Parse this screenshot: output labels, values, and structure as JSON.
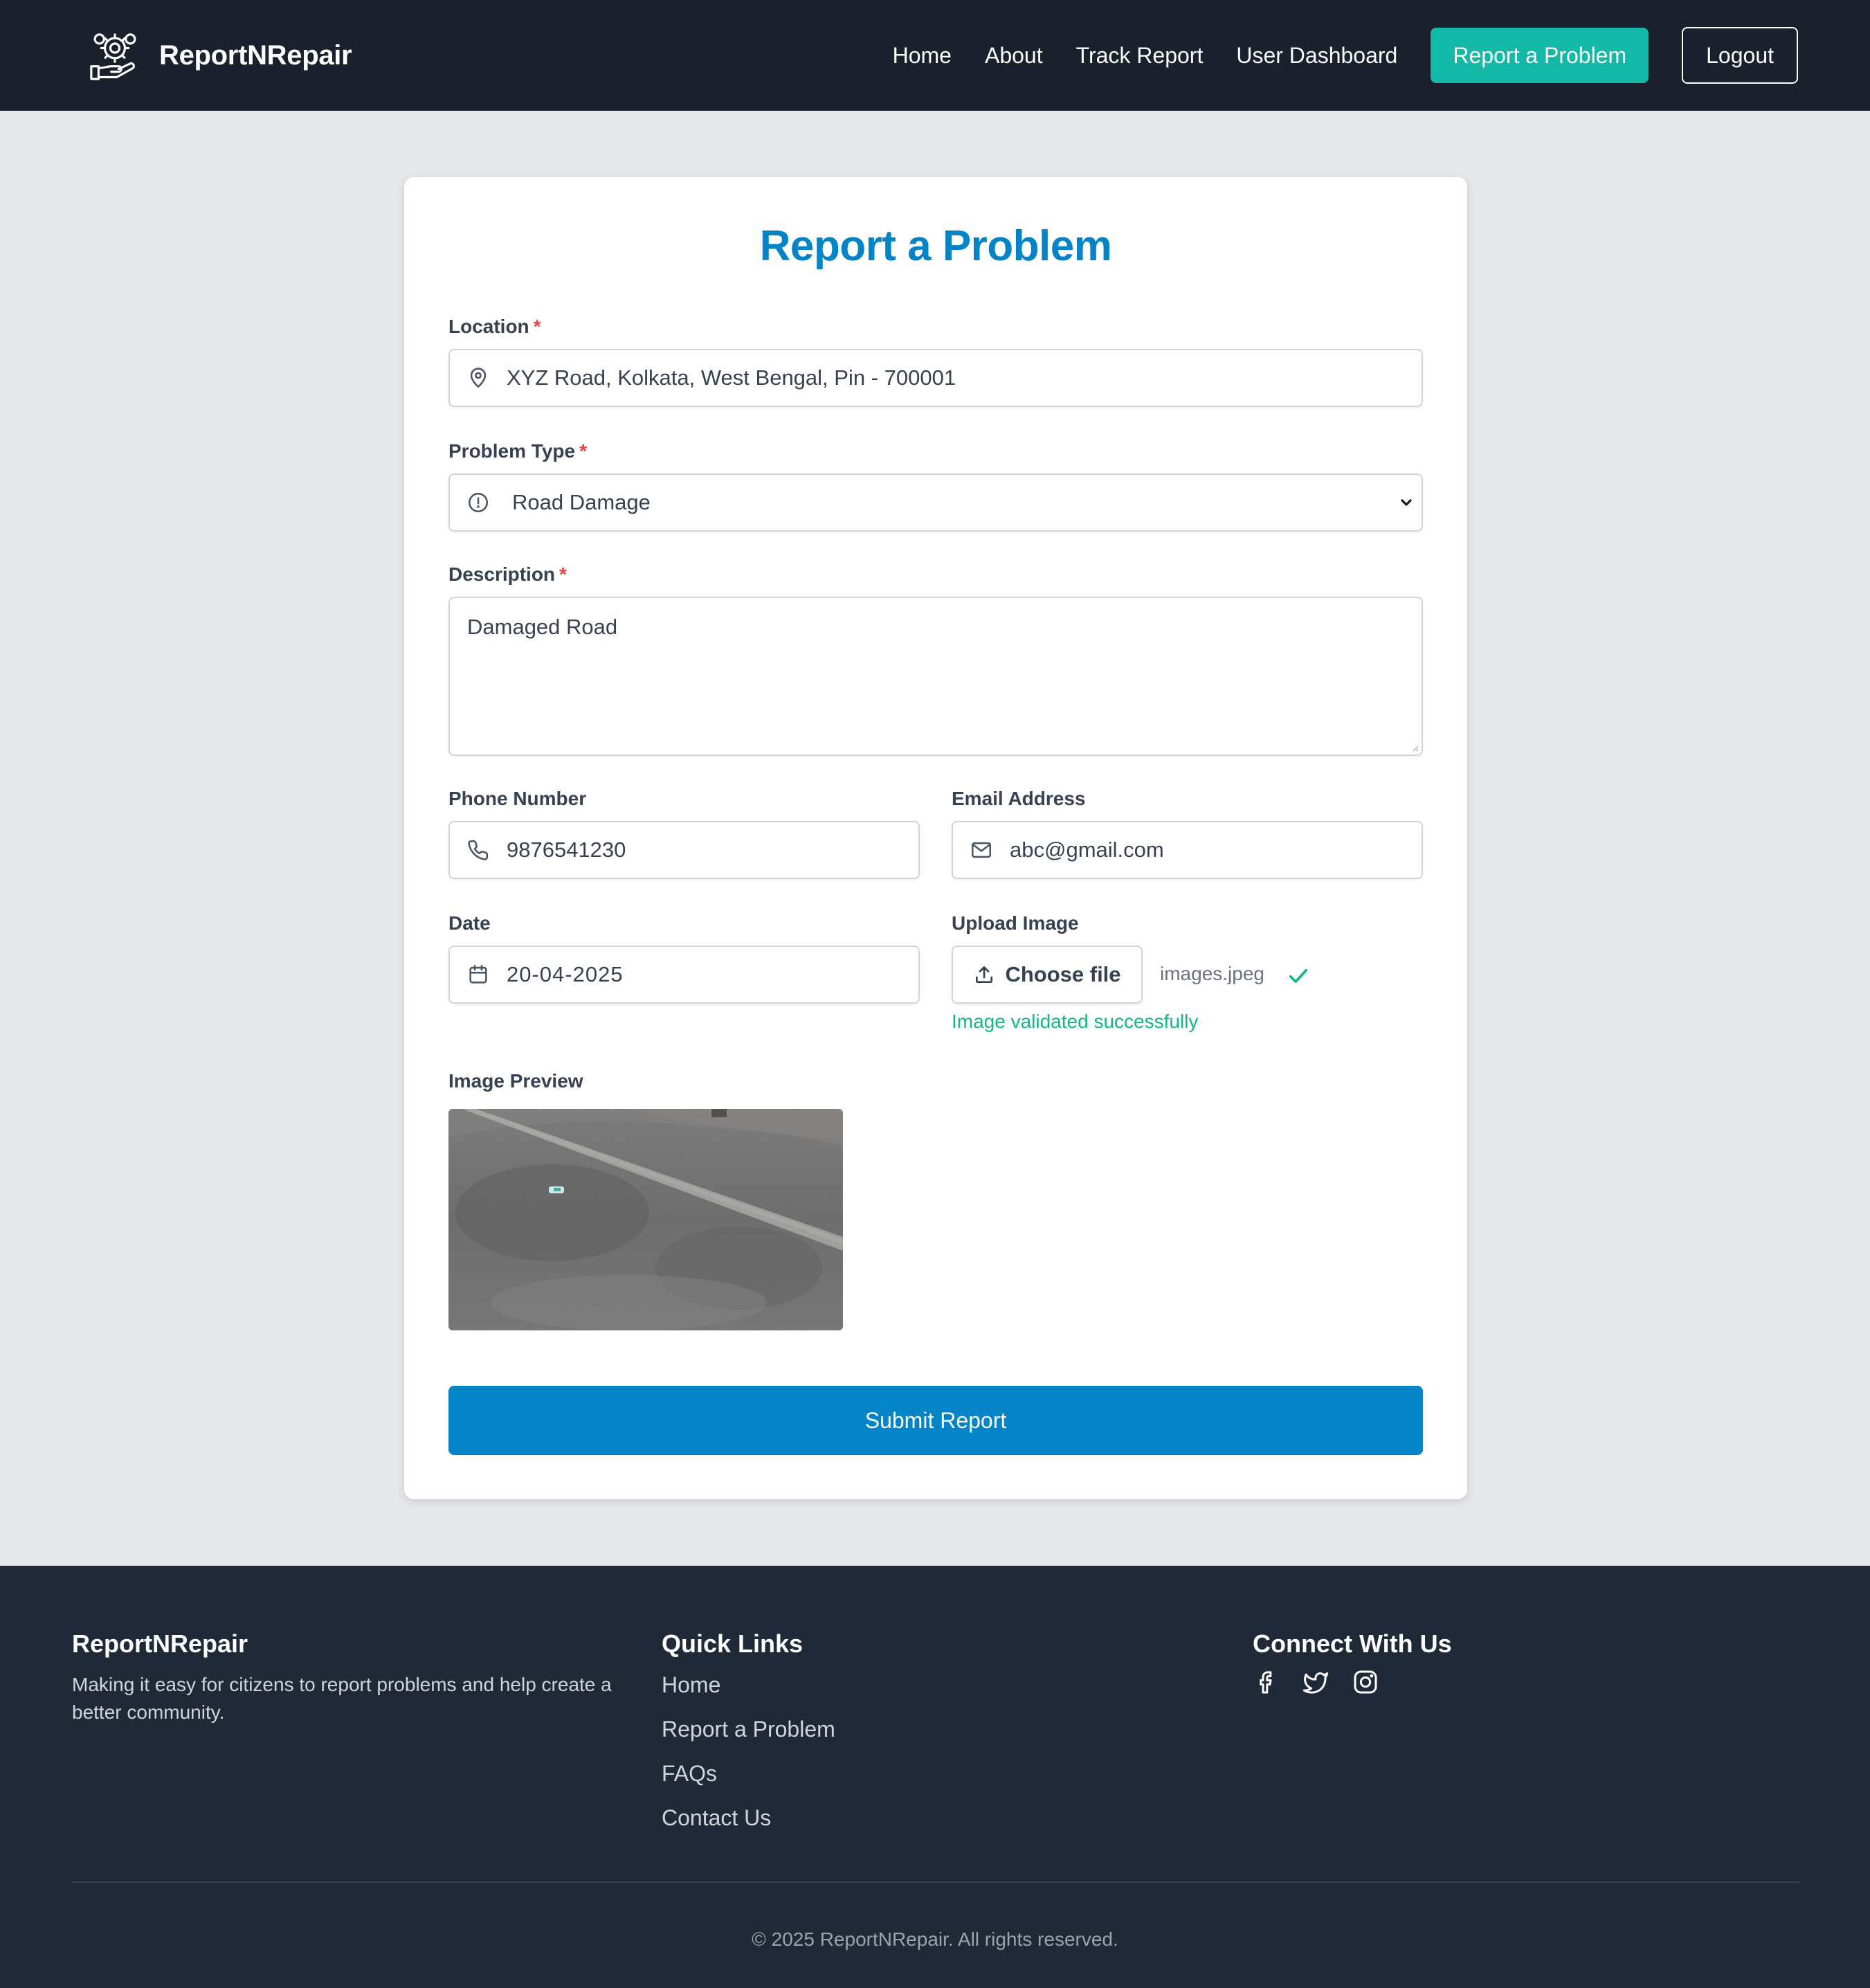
{
  "nav": {
    "brand": "ReportNRepair",
    "links": [
      "Home",
      "About",
      "Track Report",
      "User Dashboard"
    ],
    "cta": "Report a Problem",
    "logout": "Logout"
  },
  "form": {
    "title": "Report a Problem",
    "required_mark": "*",
    "location": {
      "label": "Location",
      "value": "XYZ Road, Kolkata, West Bengal, Pin - 700001"
    },
    "problem_type": {
      "label": "Problem Type",
      "value": "Road Damage"
    },
    "description": {
      "label": "Description",
      "value": "Damaged Road"
    },
    "phone": {
      "label": "Phone Number",
      "value": "9876541230"
    },
    "email": {
      "label": "Email Address",
      "value": "abc@gmail.com"
    },
    "date": {
      "label": "Date",
      "value": "20-04-2025"
    },
    "upload": {
      "label": "Upload Image",
      "button": "Choose file",
      "file_name": "images.jpeg",
      "status": "Image validated successfully"
    },
    "preview_label": "Image Preview",
    "submit": "Submit Report"
  },
  "footer": {
    "brand": "ReportNRepair",
    "description": "Making it easy for citizens to report problems and help create a better community.",
    "quick_links_title": "Quick Links",
    "quick_links": [
      "Home",
      "Report a Problem",
      "FAQs",
      "Contact Us"
    ],
    "connect_title": "Connect With Us",
    "social_icons": [
      "facebook-icon",
      "twitter-icon",
      "instagram-icon"
    ],
    "copyright": "© 2025 ReportNRepair. All rights reserved."
  },
  "colors": {
    "nav_bg": "#1a202c",
    "page_bg": "#e5e7eb",
    "accent_blue": "#0284c7",
    "accent_teal": "#14b8a6",
    "success": "#10b981",
    "required": "#ef4444",
    "footer_bg": "#1f2937"
  }
}
